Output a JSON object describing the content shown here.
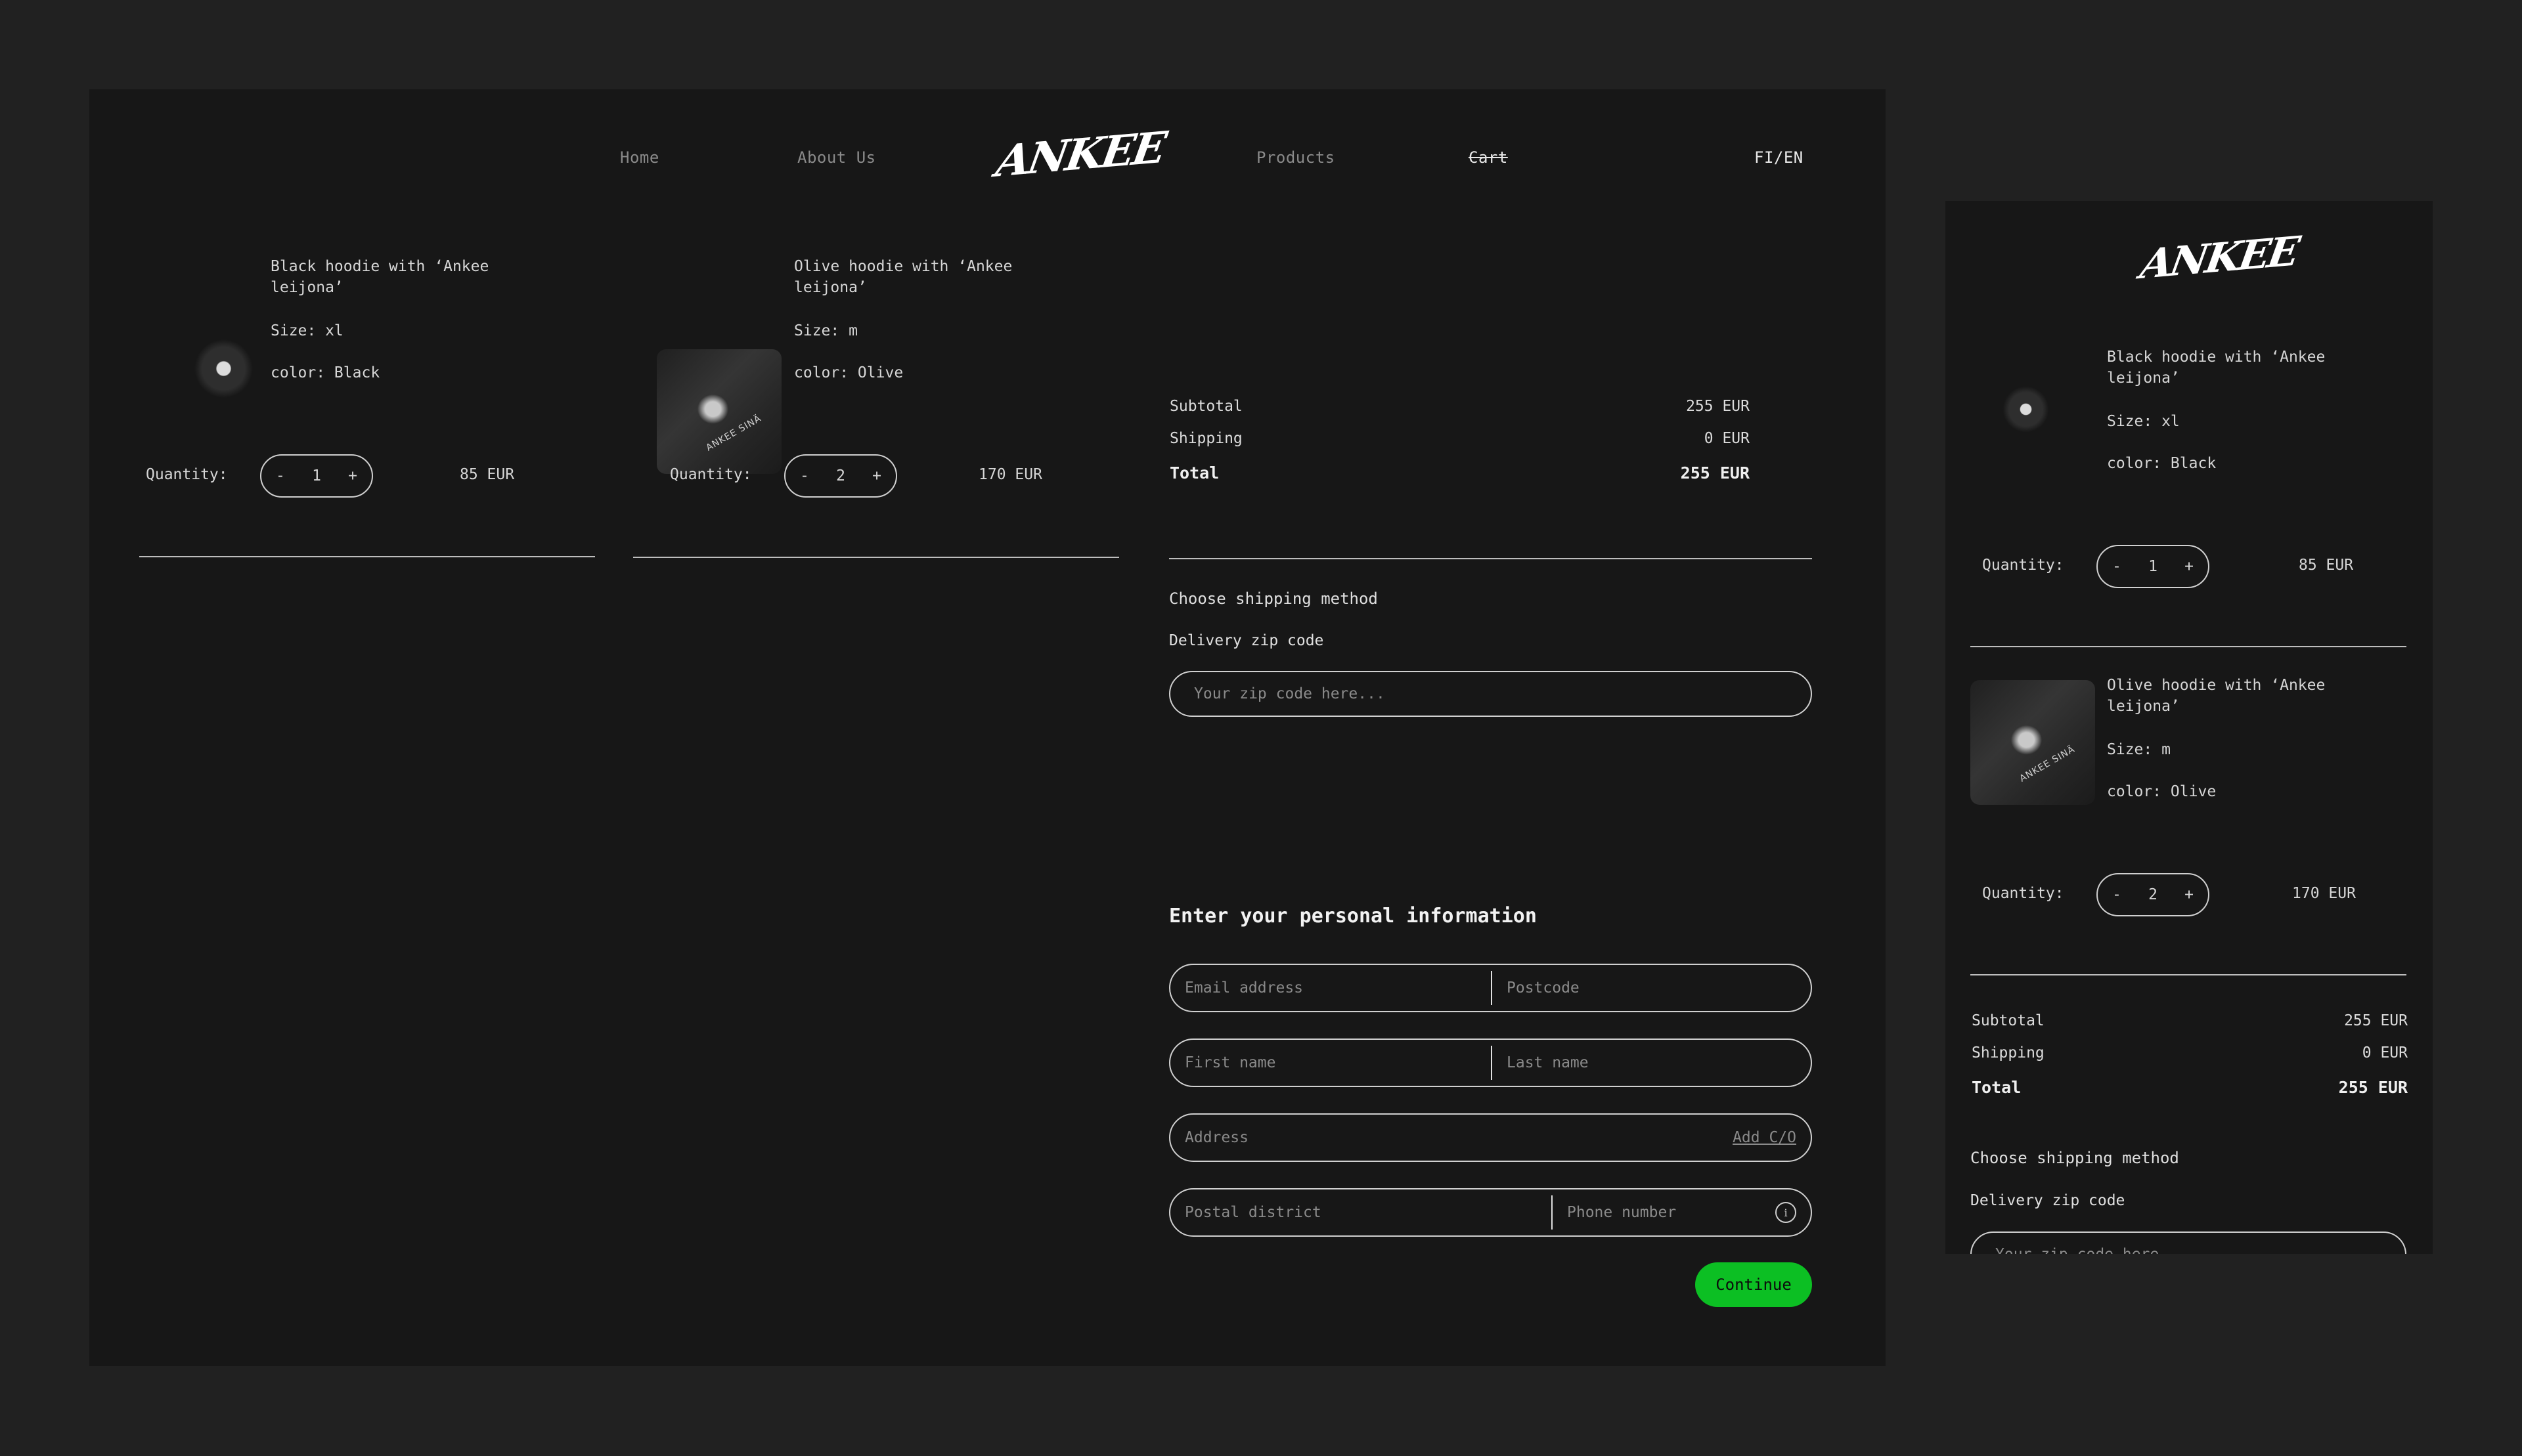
{
  "nav": {
    "items": [
      {
        "label": "Home"
      },
      {
        "label": "About Us"
      },
      {
        "label": "Products"
      },
      {
        "label": "Cart"
      }
    ],
    "logo": "ANKEE",
    "language": "FI/EN"
  },
  "cart": {
    "quantity_label": "Quantity:",
    "items": [
      {
        "name": "Black hoodie with ‘Ankee leijona’",
        "size": "Size: xl",
        "color": "color: Black",
        "quantity": "1",
        "price": "85 EUR",
        "image": "black-hoodie"
      },
      {
        "name": "Olive hoodie with ‘Ankee leijona’",
        "size": "Size: m",
        "color": "color: Olive",
        "quantity": "2",
        "price": "170 EUR",
        "image": "olive-hoodie",
        "print_text": "ANKEE SINÄ"
      }
    ],
    "decrement": "-",
    "increment": "+"
  },
  "summary": {
    "subtotal_label": "Subtotal",
    "subtotal": "255 EUR",
    "shipping_label": "Shipping",
    "shipping": "0 EUR",
    "total_label": "Total",
    "total": "255 EUR"
  },
  "shipping_method": {
    "title": "Choose shipping method",
    "zip_label": "Delivery zip code",
    "zip_placeholder": "Your zip code here...",
    "zip_value": ""
  },
  "personal_info": {
    "title": "Enter your personal information",
    "email_placeholder": "Email address",
    "postcode_placeholder": "Postcode",
    "first_name_placeholder": "First name",
    "last_name_placeholder": "Last name",
    "address_placeholder": "Address",
    "add_co_label": "Add C/O",
    "postal_district_placeholder": "Postal district",
    "phone_placeholder": "Phone number",
    "info_icon": "i",
    "continue_label": "Continue"
  },
  "colors": {
    "background": "#212121",
    "panel": "#171717",
    "accent_green": "#0cbf23",
    "text": "#dcdcdc",
    "muted": "#8a8a8a"
  }
}
